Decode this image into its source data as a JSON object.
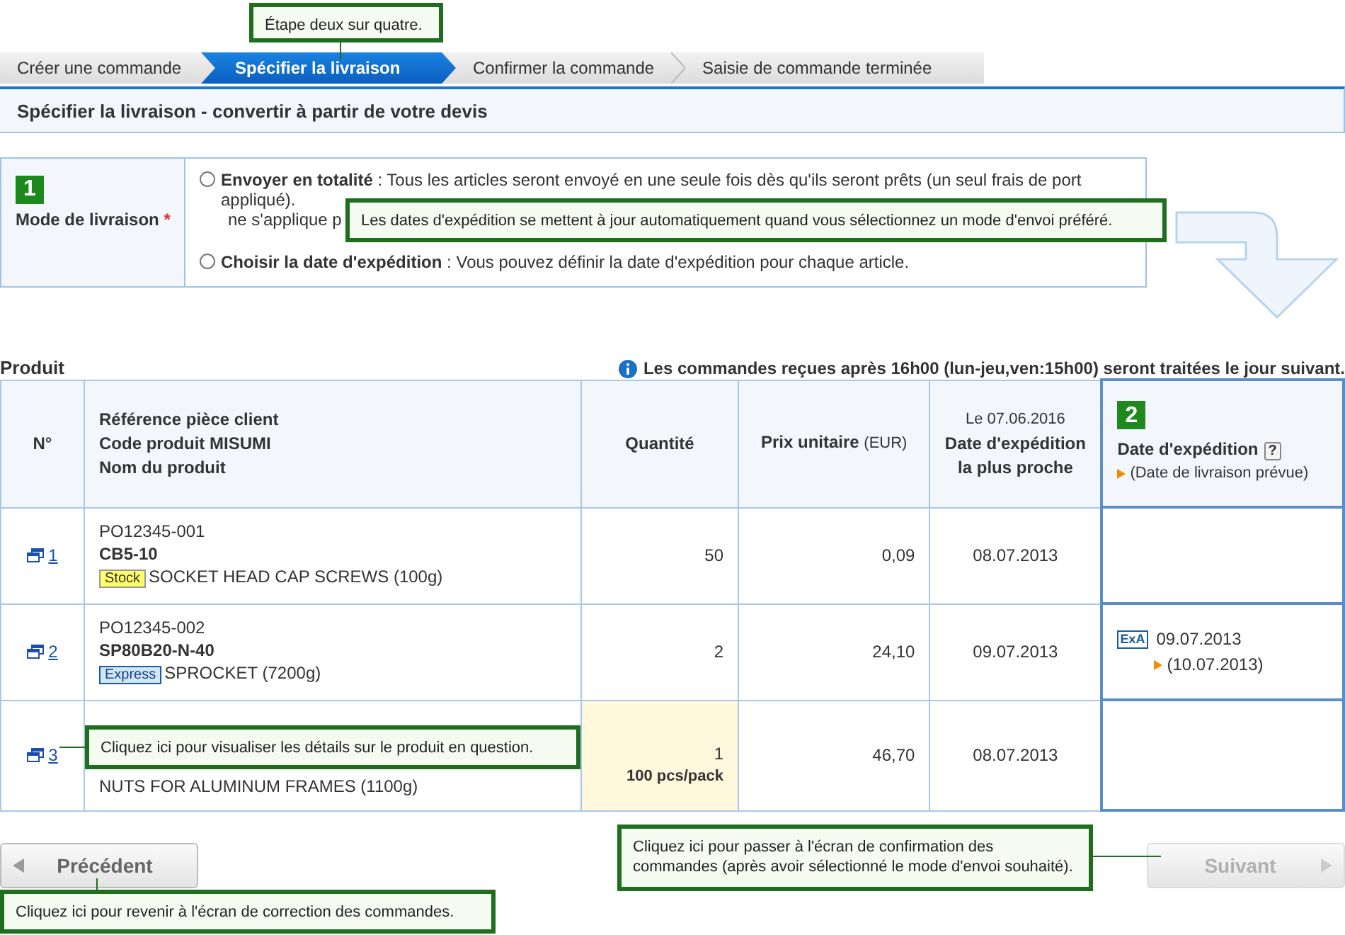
{
  "steps": [
    {
      "label": "Créer une commande",
      "selected": false
    },
    {
      "label": "Spécifier la livraison",
      "selected": true
    },
    {
      "label": "Confirmer la commande",
      "selected": false
    },
    {
      "label": "Saisie de commande terminée",
      "selected": false
    }
  ],
  "step_callout": "Étape deux sur quatre.",
  "page_title": "Spécifier la livraison - convertir à partir de votre devis",
  "delivery": {
    "badge": "1",
    "label": "Mode de livraison",
    "required": "*",
    "options": [
      {
        "text": "**Envoyer en totalité** : Tous les articles seront envoyé en une seule fois dès qu'ils seront prêts (un seul frais de port appliqué).",
        "note": "ne s'applique p",
        "selected": false
      },
      {
        "text": "**Choisir la date d'expédition** : Vous pouvez définir la date d'expédition pour chaque article.",
        "selected": false
      }
    ],
    "callout": "Les dates d'expédition se mettent à jour automatiquement quand vous sélectionnez un mode d'envoi préféré."
  },
  "products": {
    "title": "Produit",
    "notice": "Les commandes reçues après 16h00 (lun-jeu,ven:15h00) seront traitées le jour suivant.",
    "columns": {
      "number": "N°",
      "reference": [
        "Référence pièce client",
        "Code produit MISUMI",
        "Nom du produit"
      ],
      "quantity": "Quantité",
      "price": "Prix unitaire",
      "price_unit": "(EUR)",
      "earliest": [
        "Le 07.06.2016",
        "Date d'expédition",
        "la plus proche"
      ],
      "ship_badge": "2",
      "ship": "Date d'expédition",
      "ship_help": "?",
      "ship_note": "(Date de livraison prévue)"
    },
    "rows": [
      {
        "number": "1",
        "reference": "PO12345-001",
        "code": "CB5-10",
        "tag": {
          "label": "Stock",
          "kind": "stock"
        },
        "name": "SOCKET HEAD CAP SCREWS (100g)",
        "quantity": "50",
        "highlighted": false,
        "price": "0,09",
        "earliest": "08.07.2013"
      },
      {
        "number": "2",
        "reference": "PO12345-002",
        "code": "SP80B20-N-40",
        "tag": {
          "label": "Express",
          "kind": "express"
        },
        "name": "SPROCKET (7200g)",
        "quantity": "2",
        "highlighted": false,
        "price": "24,10",
        "earliest": "09.07.2013",
        "ship": {
          "service": "ExA",
          "date": "09.07.2013",
          "delivery": "(10.07.2013)"
        }
      },
      {
        "number": "3",
        "name": "NUTS FOR ALUMINUM FRAMES (1100g)",
        "quantity": "1",
        "pack": "100 pcs/pack",
        "highlighted": true,
        "price": "46,70",
        "earliest": "08.07.2013"
      }
    ],
    "callout": "Cliquez ici pour visualiser les détails sur le produit en question."
  },
  "back": {
    "label": "Précédent",
    "disabled": false,
    "callout": "Cliquez ici pour revenir à l'écran de correction des commandes."
  },
  "next": {
    "label": "Suivant",
    "disabled": true,
    "callout": "Cliquez ici pour passer à l'écran de confirmation des commandes (après avoir sélectionné le mode d'envoi souhaité)."
  }
}
